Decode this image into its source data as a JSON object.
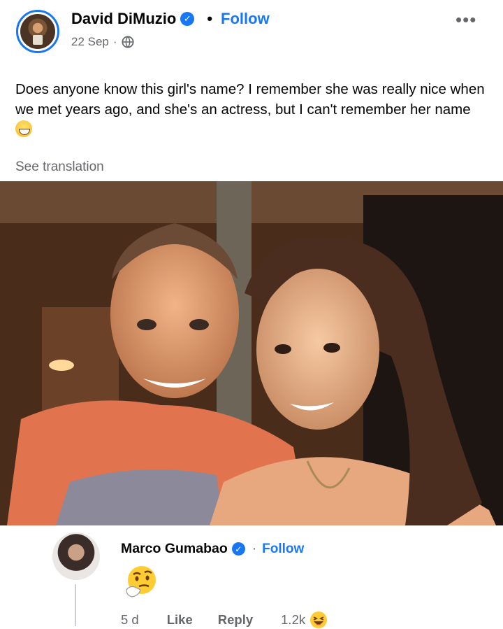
{
  "post": {
    "author": "David DiMuzio",
    "follow": "Follow",
    "separator": "•",
    "date": "22 Sep",
    "date_sep": "·",
    "privacy_icon": "globe-icon",
    "more_icon": "more-options-icon",
    "text": "Does anyone know this girl's name? I remember she was really nice when we met years ago, and she's an actress, but I can't remember her name",
    "text_emoji": "grinning-sweat-emoji",
    "see_translation": "See translation"
  },
  "photo": {
    "description_icon": "post-photo"
  },
  "comment": {
    "author": "Marco Gumabao",
    "separator": "·",
    "follow": "Follow",
    "reaction_emoji": "thinking-face-emoji",
    "age": "5 d",
    "like": "Like",
    "reply": "Reply",
    "reaction_count": "1.2k",
    "reaction_icon": "laughing-reaction-icon"
  },
  "colors": {
    "accent": "#1877f2",
    "secondary_text": "#65676b",
    "primary_text": "#050505"
  }
}
